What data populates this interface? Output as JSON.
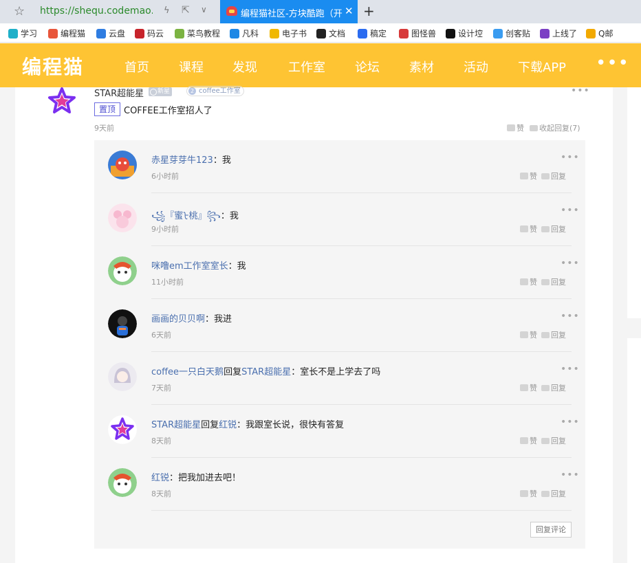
{
  "browser": {
    "url": "https://shequ.codemao.c",
    "active_tab_title": "编程猫社区-方块酷跑（开源",
    "bookmarks": [
      {
        "label": "学习",
        "color": "#1fb0c9"
      },
      {
        "label": "编程猫",
        "color": "#e8563b"
      },
      {
        "label": "云盘",
        "color": "#2f7de1"
      },
      {
        "label": "码云",
        "color": "#c7242b"
      },
      {
        "label": "菜鸟教程",
        "color": "#7cb342"
      },
      {
        "label": "凡科",
        "color": "#1e88e5"
      },
      {
        "label": "电子书",
        "color": "#f0b800"
      },
      {
        "label": "文档",
        "color": "#222222"
      },
      {
        "label": "稿定",
        "color": "#2b6cf0"
      },
      {
        "label": "图怪兽",
        "color": "#d73a3a"
      },
      {
        "label": "设计埪",
        "color": "#111111"
      },
      {
        "label": "创客贴",
        "color": "#3a9cf0"
      },
      {
        "label": "上线了",
        "color": "#7b3fc4"
      },
      {
        "label": "Q邮",
        "color": "#f2a900"
      }
    ]
  },
  "site": {
    "logo": "编程猫",
    "nav": [
      "首页",
      "课程",
      "发现",
      "工作室",
      "论坛",
      "素材",
      "活动",
      "下载APP"
    ],
    "nav_more": "•••",
    "brand_color": "#fec433"
  },
  "post": {
    "author": "STAR超能星",
    "badge_new": "新星",
    "badge_studio": "coffee工作室",
    "pin_label": "置顶",
    "text": "COFFEE工作室招人了",
    "time": "9天前",
    "like_label": "赞",
    "collapse_label": "收起回复(7)",
    "more": "•••"
  },
  "replies": [
    {
      "user": "赤星芽芽牛123",
      "reply_to": "",
      "text": "：我",
      "time": "6小时前",
      "avatar": "game"
    },
    {
      "user": "꧁『蜜ᡶ桃』꧂",
      "reply_to": "",
      "text": "：我",
      "time": "9小时前",
      "avatar": "pink"
    },
    {
      "user": "咪噜em工作室室长",
      "reply_to": "",
      "text": "：我",
      "time": "11小时前",
      "avatar": "cat"
    },
    {
      "user": "画画的贝贝啊",
      "reply_to": "",
      "text": "：我进",
      "time": "6天前",
      "avatar": "dark"
    },
    {
      "user": "coffee一只白天鹅",
      "reply_to": "STAR超能星",
      "text": "：室长不是上学去了吗",
      "time": "7天前",
      "avatar": "girl"
    },
    {
      "user": "STAR超能星",
      "reply_to": "红锐",
      "text": "：我跟室长说，很快有答复",
      "time": "8天前",
      "avatar": "star"
    },
    {
      "user": "红锐",
      "reply_to": "",
      "text": "：把我加进去吧！",
      "time": "8天前",
      "avatar": "cat"
    }
  ],
  "reply_word": "回复",
  "like_word": "赞",
  "reply_comment_button": "回复评论"
}
